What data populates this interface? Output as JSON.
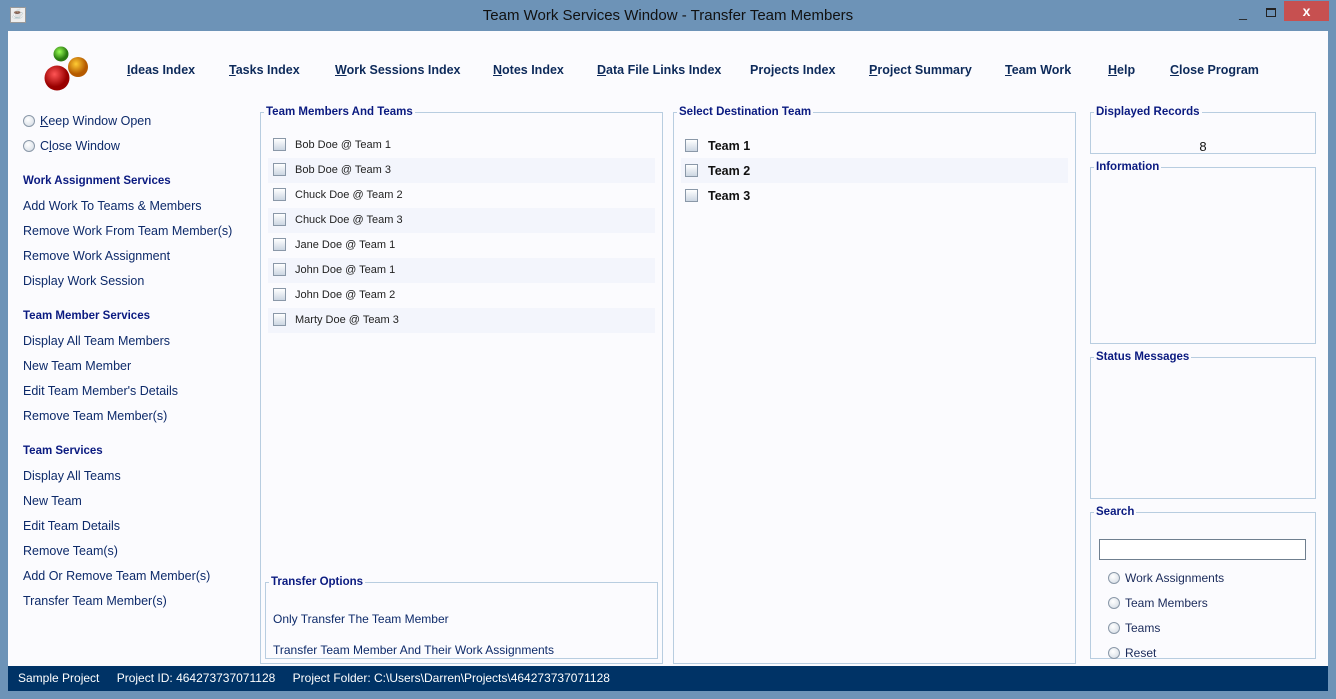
{
  "window": {
    "title": "Team Work Services Window - Transfer Team Members",
    "minimize": "_",
    "close": "x"
  },
  "nav": [
    {
      "u": "I",
      "rest": "deas Index"
    },
    {
      "u": "T",
      "rest": "asks Index"
    },
    {
      "u": "W",
      "rest": "ork Sessions Index"
    },
    {
      "u": "N",
      "rest": "otes Index"
    },
    {
      "u": "D",
      "rest": "ata File Links Index"
    },
    {
      "u": "",
      "rest": "Projects Index"
    },
    {
      "u": "P",
      "rest": "roject Summary"
    },
    {
      "u": "T",
      "rest": "eam Work"
    },
    {
      "u": "H",
      "rest": "elp"
    },
    {
      "u": "C",
      "rest": "lose Program"
    }
  ],
  "window_options": [
    {
      "u": "K",
      "rest": "eep Window Open"
    },
    {
      "pre": "C",
      "u": "l",
      "rest": "ose Window"
    }
  ],
  "sidebar": {
    "work_head": "Work Assignment Services",
    "work": [
      "Add Work To Teams & Members",
      "Remove Work From Team Member(s)",
      "Remove Work Assignment",
      "Display Work Session"
    ],
    "member_head": "Team Member Services",
    "member": [
      "Display All Team Members",
      "New Team Member",
      "Edit Team Member's Details",
      "Remove Team Member(s)"
    ],
    "team_head": "Team Services",
    "team": [
      "Display All Teams",
      "New Team",
      "Edit Team Details",
      "Remove Team(s)",
      "Add Or Remove Team Member(s)",
      "Transfer Team Member(s)"
    ]
  },
  "members_panel": {
    "title": "Team Members And Teams",
    "items": [
      "Bob Doe @ Team 1",
      "Bob Doe @ Team 3",
      "Chuck Doe @ Team 2",
      "Chuck Doe @ Team 3",
      "Jane Doe @ Team 1",
      "John Doe @ Team 1",
      "John Doe @ Team 2",
      "Marty Doe @ Team 3"
    ]
  },
  "transfer_options": {
    "title": "Transfer Options",
    "options": [
      "Only Transfer The Team Member",
      "Transfer Team Member And Their Work Assignments"
    ]
  },
  "destination_panel": {
    "title": "Select Destination Team",
    "teams": [
      "Team 1",
      "Team 2",
      "Team 3"
    ]
  },
  "displayed_records": {
    "title": "Displayed Records",
    "value": "8"
  },
  "information": {
    "title": "Information"
  },
  "status_messages": {
    "title": "Status Messages"
  },
  "search": {
    "title": "Search",
    "value": "",
    "options": [
      "Work Assignments",
      "Team Members",
      "Teams",
      "Reset"
    ]
  },
  "statusbar": {
    "project": "Sample Project",
    "project_id": "Project ID:  464273737071128",
    "folder": "Project Folder: C:\\Users\\Darren\\Projects\\464273737071128"
  },
  "colors": {
    "frame": "#6d93b7",
    "statusbar": "#003366",
    "heading": "#0a1a80",
    "close": "#c75050"
  }
}
